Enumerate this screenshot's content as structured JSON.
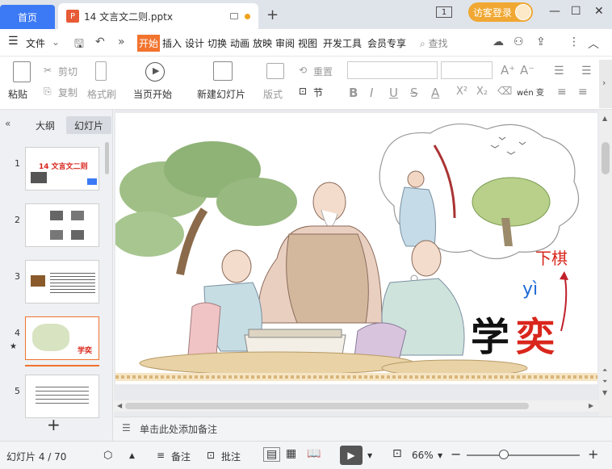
{
  "titlebar": {
    "home_tab": "首页",
    "doc_tab": "14 文言文二则.pptx",
    "ppt_icon_letter": "P",
    "add_tab": "+",
    "window_count": "1",
    "visitor_login": "访客登录",
    "minimize": "—",
    "maximize": "☐",
    "close": "✕"
  },
  "menu": {
    "file": "文件",
    "tabs": [
      "开始",
      "插入",
      "设计",
      "切换",
      "动画",
      "放映",
      "审阅",
      "视图",
      "开发工具",
      "会员专享"
    ],
    "search": "查找"
  },
  "ribbon": {
    "paste": "粘贴",
    "cut": "剪切",
    "copy": "复制",
    "format_painter": "格式刷",
    "start_from_current": "当页开始",
    "new_slide": "新建幻灯片",
    "layout": "版式",
    "reset": "重置",
    "section": "节",
    "bold": "B",
    "italic": "I",
    "underline": "U",
    "strike": "S",
    "font_color": "A",
    "superscript": "X²",
    "subscript": "X₂",
    "phonetic": "wén 变",
    "grow_font": "A⁺",
    "shrink_font": "A⁻"
  },
  "leftpanel": {
    "outline_tab": "大纲",
    "slides_tab": "幻灯片",
    "thumbnails": [
      {
        "num": "1",
        "title": "14 文言文二则"
      },
      {
        "num": "2",
        "title": ""
      },
      {
        "num": "3",
        "title": ""
      },
      {
        "num": "4",
        "title": "学奕"
      },
      {
        "num": "5",
        "title": ""
      }
    ],
    "add_slide": "+"
  },
  "slide": {
    "char_xue": "学",
    "char_yi": "奕",
    "pinyin": "yì",
    "annotation": "下棋"
  },
  "notes": {
    "placeholder": "单击此处添加备注"
  },
  "status": {
    "slide_counter": "幻灯片 4 / 70",
    "notes_btn": "备注",
    "comment_btn": "批注",
    "zoom": "66%",
    "zoom_fraction": 0.33
  },
  "colors": {
    "accent": "#f2732e",
    "home_tab": "#3c7af5",
    "visitor": "#f0a833",
    "slide_red": "#d9261c",
    "pinyin_blue": "#1f6bd6"
  }
}
